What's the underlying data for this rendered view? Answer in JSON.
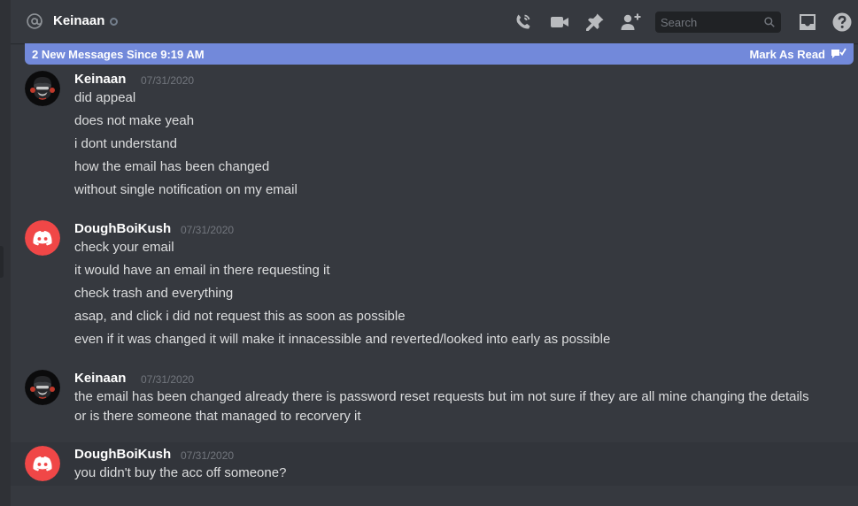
{
  "header": {
    "channel_name": "Keinaan",
    "search_placeholder": "Search"
  },
  "new_messages_bar": {
    "text": "2 New Messages Since 9:19 AM",
    "mark_as_read": "Mark As Read"
  },
  "messages": [
    {
      "username": "Keinaan",
      "timestamp": "07/31/2020",
      "avatar": "custom-avatar",
      "lines": [
        "did appeal",
        "does not make yeah",
        "i dont understand",
        "how the email has been changed",
        "without single notification on my email"
      ]
    },
    {
      "username": "DoughBoiKush",
      "timestamp": "07/31/2020",
      "avatar": "discord-default-avatar",
      "lines": [
        "check your email",
        "it would have an email in there requesting it",
        "check trash and everything",
        "asap, and click i did not request this as soon as possible",
        "even if it was changed it will make it innacessible and reverted/looked into early as possible"
      ]
    },
    {
      "username": "Keinaan",
      "timestamp": "07/31/2020",
      "avatar": "custom-avatar",
      "lines": [
        "the email has been changed already there is password reset requests but im not sure if they are all mine changing the details",
        "or is there someone that managed to recorvery it"
      ]
    },
    {
      "username": "DoughBoiKush",
      "timestamp": "07/31/2020",
      "avatar": "discord-default-avatar",
      "lines": [
        "you didn't buy the acc off someone?"
      ]
    }
  ],
  "colors": {
    "background": "#36393f",
    "accent": "#7289da",
    "discord_red": "#f04747",
    "text": "#dcddde",
    "muted": "#72767d"
  }
}
